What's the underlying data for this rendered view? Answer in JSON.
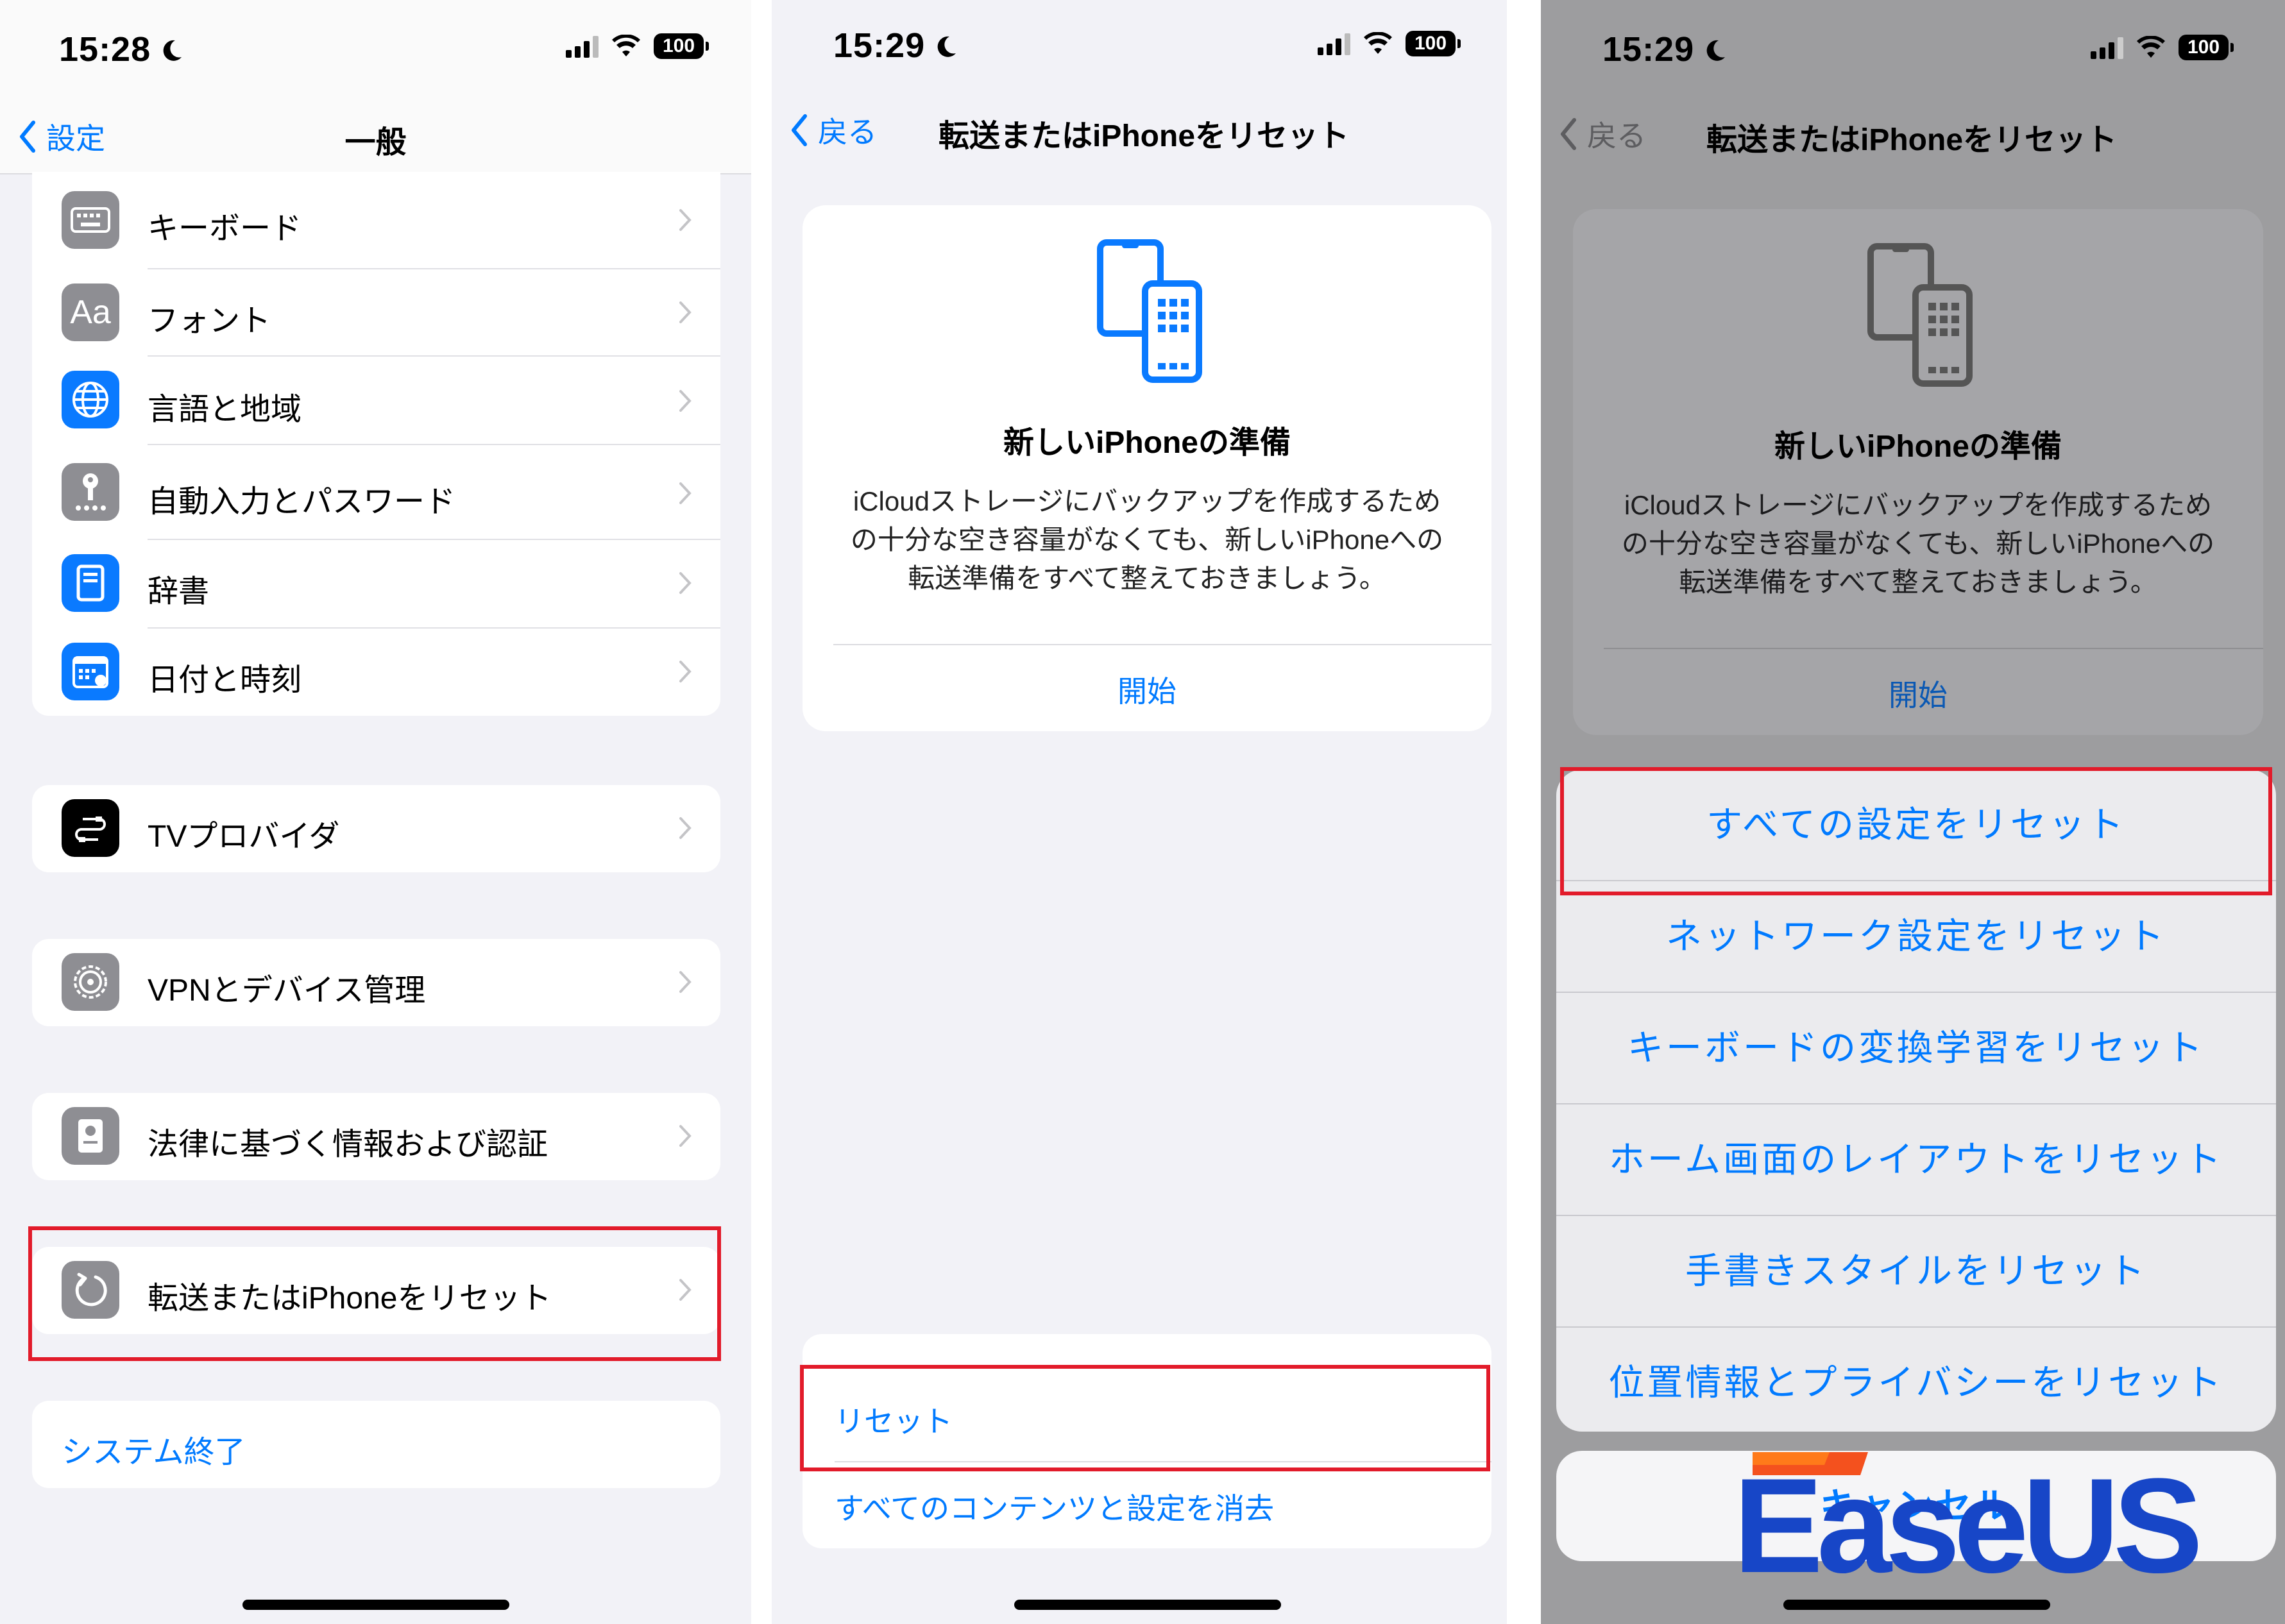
{
  "colors": {
    "accent": "#007aff",
    "highlight": "#e21b2a"
  },
  "panel1": {
    "time": "15:28",
    "battery": "100",
    "back_label": "設定",
    "title": "一般",
    "items": [
      {
        "label": "キーボード",
        "icon": "keyboard-icon"
      },
      {
        "label": "フォント",
        "icon": "font-icon",
        "glyph": "Aa"
      },
      {
        "label": "言語と地域",
        "icon": "globe-icon"
      },
      {
        "label": "自動入力とパスワード",
        "icon": "key-icon"
      },
      {
        "label": "辞書",
        "icon": "dictionary-icon"
      },
      {
        "label": "日付と時刻",
        "icon": "calendar-icon"
      }
    ],
    "tv_provider": "TVプロバイダ",
    "vpn": "VPNとデバイス管理",
    "legal": "法律に基づく情報および認証",
    "transfer_reset": "転送またはiPhoneをリセット",
    "shutdown": "システム終了"
  },
  "panel2": {
    "time": "15:29",
    "battery": "100",
    "back_label": "戻る",
    "title": "転送またはiPhoneをリセット",
    "card": {
      "title": "新しいiPhoneの準備",
      "body": "iCloudストレージにバックアップを作成するための十分な空き容量がなくても、新しいiPhoneへの転送準備をすべて整えておきましょう。",
      "button": "開始"
    },
    "reset_label": "リセット",
    "erase_label": "すべてのコンテンツと設定を消去"
  },
  "panel3": {
    "time": "15:29",
    "battery": "100",
    "back_label": "戻る",
    "title": "転送またはiPhoneをリセット",
    "card": {
      "title": "新しいiPhoneの準備",
      "body": "iCloudストレージにバックアップを作成するための十分な空き容量がなくても、新しいiPhoneへの転送準備をすべて整えておきましょう。",
      "button": "開始"
    },
    "options": [
      "すべての設定をリセット",
      "ネットワーク設定をリセット",
      "キーボードの変換学習をリセット",
      "ホーム画面のレイアウトをリセット",
      "手書きスタイルをリセット",
      "位置情報とプライバシーをリセット"
    ],
    "cancel": "キャンセル"
  },
  "watermark": "EaseUS"
}
